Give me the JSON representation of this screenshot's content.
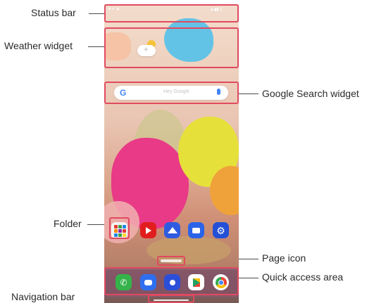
{
  "callouts": {
    "status_bar": "Status bar",
    "weather_widget": "Weather widget",
    "google_search_widget": "Google Search widget",
    "folder": "Folder",
    "page_icon": "Page icon",
    "quick_access_area": "Quick access area",
    "navigation_bar": "Navigation bar"
  },
  "search": {
    "logo": "G",
    "placeholder": "Hey Google"
  },
  "colors": {
    "callout_outline": "#e04a5f",
    "accent_blue": "#4285f4"
  },
  "home_apps": [
    {
      "name": "youtube-icon"
    },
    {
      "name": "gallery-icon"
    },
    {
      "name": "video-call-icon"
    },
    {
      "name": "settings-icon"
    }
  ],
  "dock_apps": [
    {
      "name": "phone-icon"
    },
    {
      "name": "messages-icon"
    },
    {
      "name": "camera-icon"
    },
    {
      "name": "play-store-icon"
    },
    {
      "name": "chrome-icon"
    }
  ]
}
